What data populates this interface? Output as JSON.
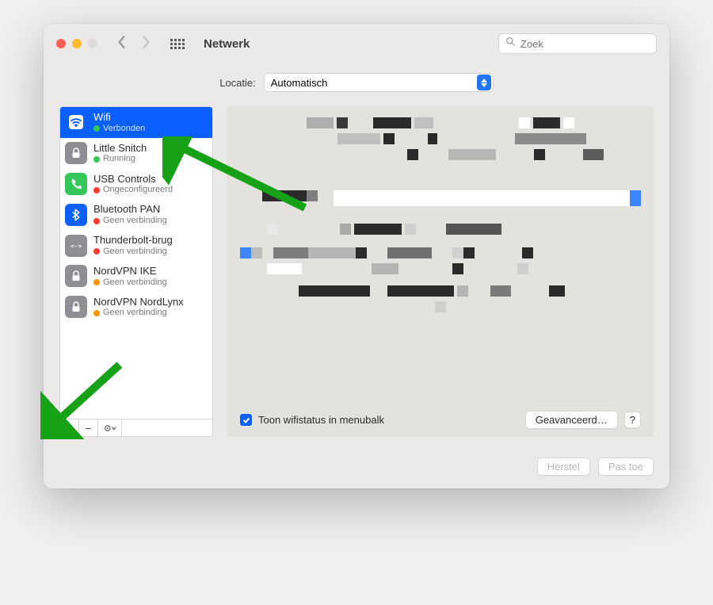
{
  "window": {
    "title": "Netwerk"
  },
  "search": {
    "placeholder": "Zoek"
  },
  "location": {
    "label": "Locatie:",
    "value": "Automatisch"
  },
  "services": [
    {
      "name": "Wifi",
      "status": "Verbonden",
      "statusColor": "#35c759",
      "iconBg": "#0a60ff",
      "icon": "wifi",
      "selected": true
    },
    {
      "name": "Little Snitch",
      "status": "Running",
      "statusColor": "#35c759",
      "iconBg": "#8e8e93",
      "icon": "lock"
    },
    {
      "name": "USB Controls",
      "status": "Ongeconfigureerd",
      "statusColor": "#ff3b30",
      "iconBg": "#34c759",
      "icon": "phone"
    },
    {
      "name": "Bluetooth PAN",
      "status": "Geen verbinding",
      "statusColor": "#ff3b30",
      "iconBg": "#0a60ff",
      "icon": "bluetooth"
    },
    {
      "name": "Thunderbolt-brug",
      "status": "Geen verbinding",
      "statusColor": "#ff3b30",
      "iconBg": "#8e8e93",
      "icon": "thunderbolt"
    },
    {
      "name": "NordVPN IKE",
      "status": "Geen verbinding",
      "statusColor": "#ff9500",
      "iconBg": "#8e8e93",
      "icon": "lock"
    },
    {
      "name": "NordVPN NordLynx",
      "status": "Geen verbinding",
      "statusColor": "#ff9500",
      "iconBg": "#8e8e93",
      "icon": "lock"
    }
  ],
  "mainPanel": {
    "checkboxLabel": "Toon wifistatus in menubalk",
    "checkboxChecked": true,
    "advancedLabel": "Geavanceerd…",
    "helpLabel": "?"
  },
  "footer": {
    "revert": "Herstel",
    "apply": "Pas toe"
  }
}
